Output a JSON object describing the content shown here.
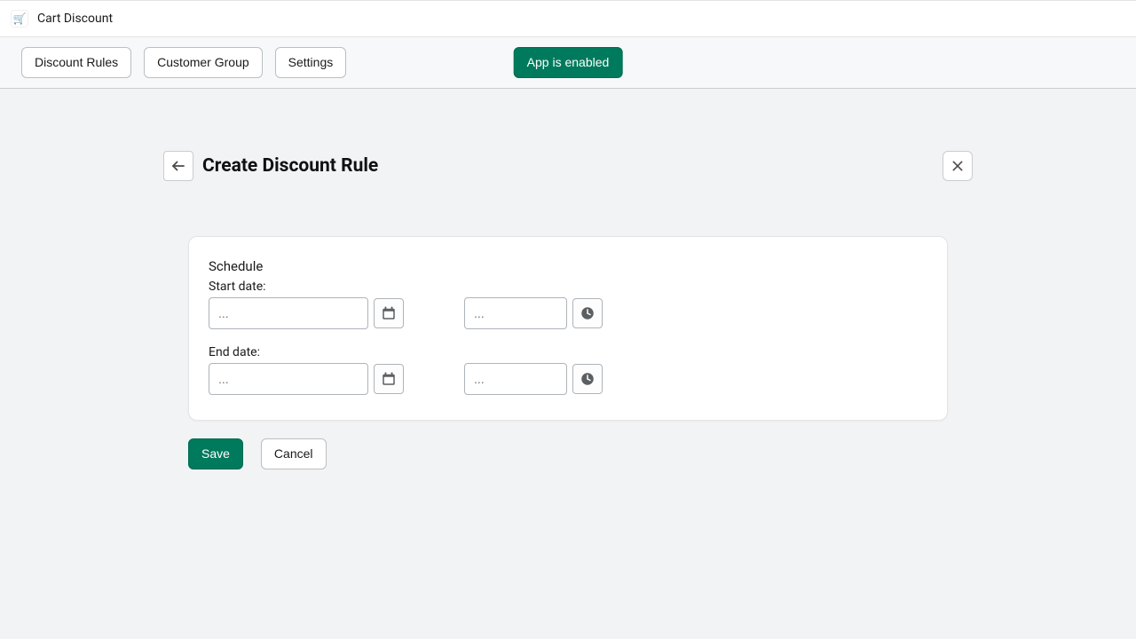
{
  "app": {
    "icon_glyph": "🛒",
    "title": "Cart Discount"
  },
  "toolbar": {
    "tabs": [
      "Discount Rules",
      "Customer Group",
      "Settings"
    ],
    "status_label": "App is enabled"
  },
  "page": {
    "title": "Create Discount Rule"
  },
  "schedule": {
    "section_label": "Schedule",
    "start": {
      "label": "Start date:",
      "date_value": "",
      "date_placeholder": "...",
      "time_value": "",
      "time_placeholder": "..."
    },
    "end": {
      "label": "End date:",
      "date_value": "",
      "date_placeholder": "...",
      "time_value": "",
      "time_placeholder": "..."
    }
  },
  "actions": {
    "save": "Save",
    "cancel": "Cancel"
  }
}
